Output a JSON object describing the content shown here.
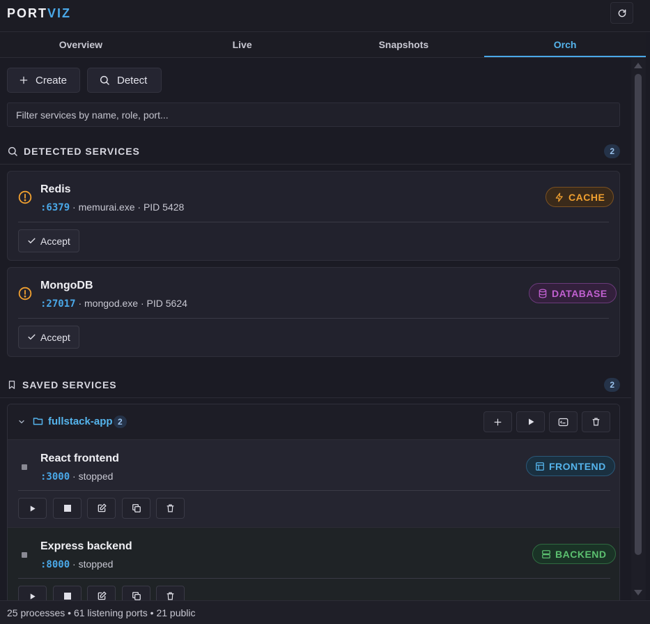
{
  "app": {
    "logo_main": "PORT",
    "logo_accent": "VIZ"
  },
  "tabs": [
    {
      "label": "Overview",
      "active": false
    },
    {
      "label": "Live",
      "active": false
    },
    {
      "label": "Snapshots",
      "active": false
    },
    {
      "label": "Orch",
      "active": true
    }
  ],
  "toolbar": {
    "create_label": "Create",
    "detect_label": "Detect"
  },
  "filter": {
    "placeholder": "Filter services by name, role, port..."
  },
  "detected": {
    "title": "DETECTED SERVICES",
    "count": "2",
    "items": [
      {
        "name": "Redis",
        "port": ":6379",
        "meta": " · memurai.exe · PID 5428",
        "role": "CACHE",
        "accept_label": "Accept"
      },
      {
        "name": "MongoDB",
        "port": ":27017",
        "meta": " · mongod.exe · PID 5624",
        "role": "DATABASE",
        "accept_label": "Accept"
      }
    ]
  },
  "saved": {
    "title": "SAVED SERVICES",
    "count": "2",
    "group": {
      "name": "fullstack-app",
      "count": "2",
      "services": [
        {
          "name": "React frontend",
          "port": ":3000",
          "status": " · stopped",
          "role": "FRONTEND"
        },
        {
          "name": "Express backend",
          "port": ":8000",
          "status": " · stopped",
          "role": "BACKEND"
        }
      ]
    }
  },
  "colors": {
    "accent": "#4aa8e8",
    "cache": "#f0a030",
    "database": "#c060d0",
    "frontend": "#55b4ec",
    "backend": "#5cc070",
    "warning": "#f0a030"
  },
  "status": {
    "text": "25 processes • 61 listening ports • 21 public"
  }
}
